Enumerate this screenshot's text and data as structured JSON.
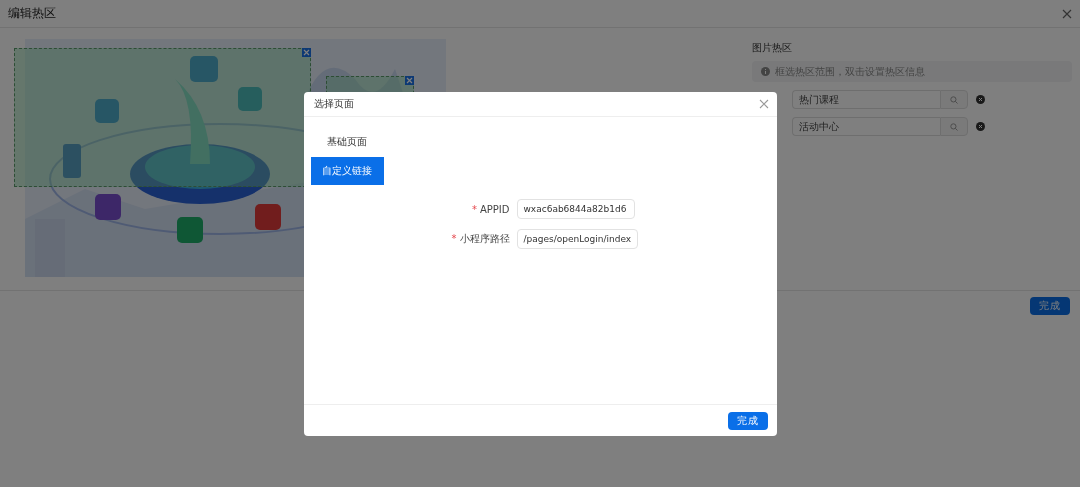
{
  "page": {
    "title": "编辑热区"
  },
  "hotspot_panel": {
    "title": "图片热区",
    "hint": "框选热区范围，双击设置热区信息",
    "hotspots": [
      {
        "value": "热门课程"
      },
      {
        "value": "活动中心"
      }
    ]
  },
  "done_button": "完成",
  "dialog": {
    "title": "选择页面",
    "tabs": [
      {
        "label": "基础页面",
        "selected": false
      },
      {
        "label": "自定义链接",
        "selected": true
      }
    ],
    "fields": [
      {
        "label": "APPID",
        "required_mark": "*",
        "value": "wxac6ab6844a82b1d6"
      },
      {
        "label": "小程序路径",
        "required_mark": "*",
        "value": "/pages/openLogin/index"
      }
    ],
    "confirm_button": "完成"
  }
}
